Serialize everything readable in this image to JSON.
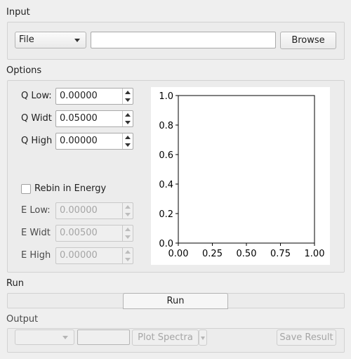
{
  "input": {
    "section_label": "Input",
    "source_combo": "File",
    "path_value": "",
    "browse_label": "Browse"
  },
  "options": {
    "section_label": "Options",
    "q_low_label": "Q Low:",
    "q_low_value": "0.00000",
    "q_width_label": "Q Widt",
    "q_width_value": "0.05000",
    "q_high_label": "Q High",
    "q_high_value": "0.00000",
    "rebin_label": "Rebin in Energy",
    "rebin_checked": false,
    "e_low_label": "E Low:",
    "e_low_value": "0.00000",
    "e_width_label": "E Widt",
    "e_width_value": "0.00500",
    "e_high_label": "E High",
    "e_high_value": "0.00000"
  },
  "plot": {
    "x_ticks": [
      "0.00",
      "0.25",
      "0.50",
      "0.75",
      "1.00"
    ],
    "y_ticks": [
      "0.0",
      "0.2",
      "0.4",
      "0.6",
      "0.8",
      "1.0"
    ]
  },
  "chart_data": {
    "type": "line",
    "series": [],
    "xlim": [
      0,
      1
    ],
    "ylim": [
      0,
      1
    ],
    "grid": false
  },
  "run": {
    "section_label": "Run",
    "run_label": "Run"
  },
  "output": {
    "section_label": "Output",
    "combo_value": "",
    "text_value": "",
    "plot_spectra_label": "Plot Spectra",
    "save_result_label": "Save Result"
  }
}
